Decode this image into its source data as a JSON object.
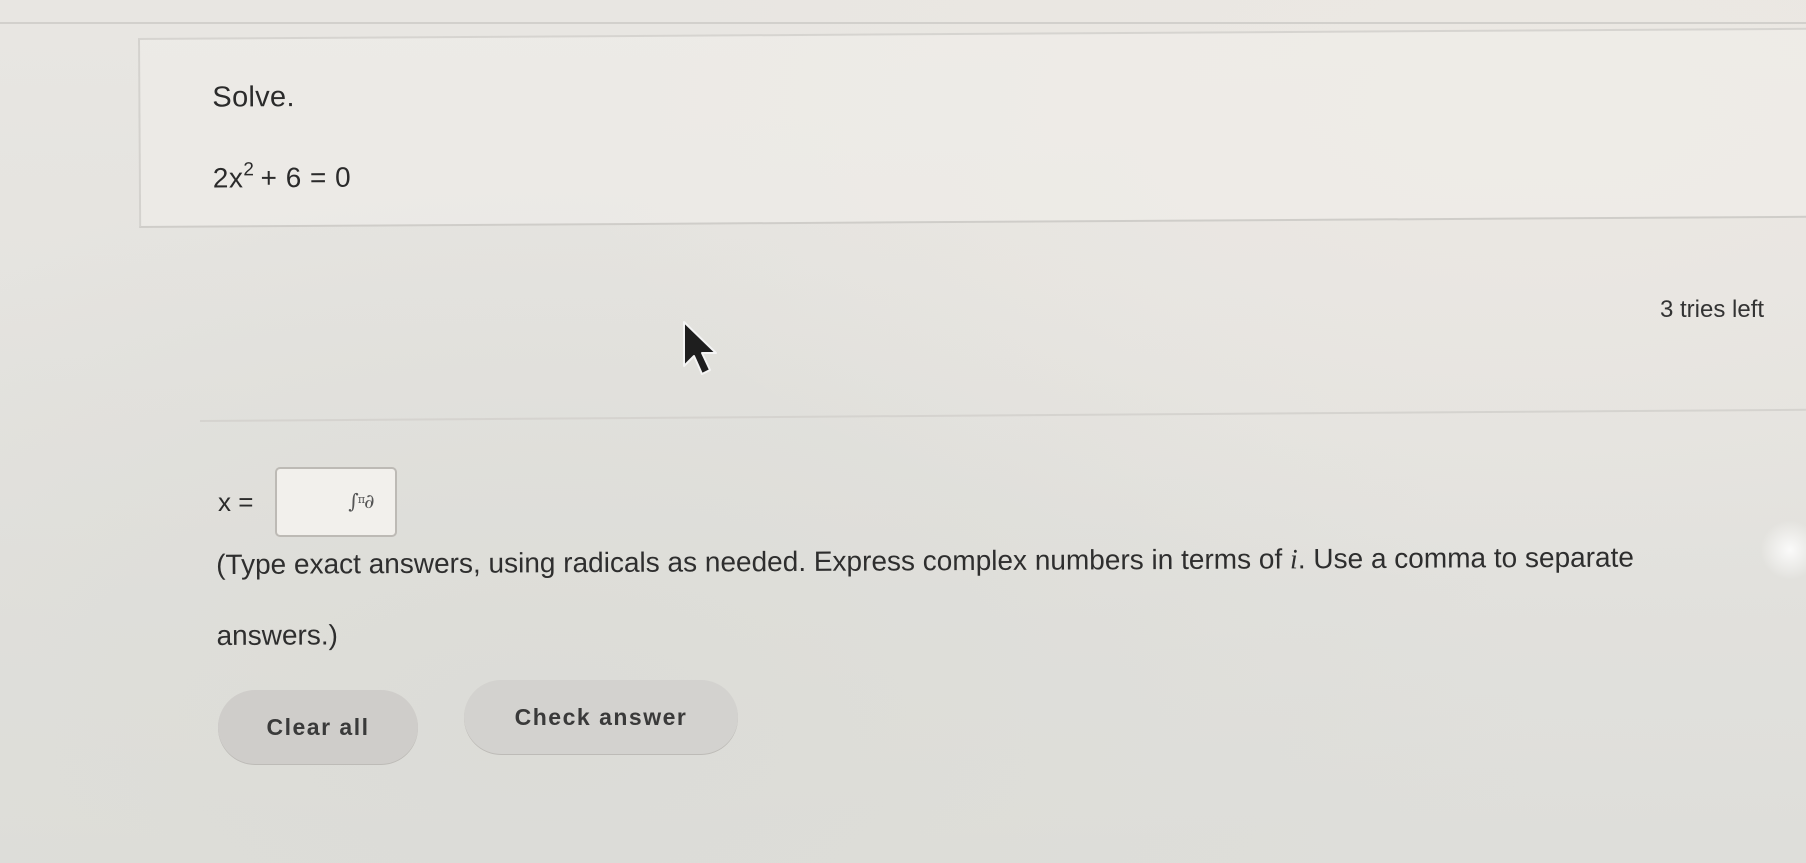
{
  "question": {
    "instruction": "Solve.",
    "equation": {
      "base": "2x",
      "exponent": "2",
      "rest": "+ 6 = 0"
    }
  },
  "status": {
    "tries_left": "3 tries left"
  },
  "answer": {
    "label": "x =",
    "value": "",
    "math_icon": "math-template-icon"
  },
  "help": {
    "text_before": "(Type exact answers, using radicals as needed. Express complex numbers in terms of ",
    "variable": "i",
    "text_after": ". Use a comma to separate answers.)"
  },
  "buttons": {
    "clear_label": "Clear all",
    "check_label": "Check answer"
  }
}
